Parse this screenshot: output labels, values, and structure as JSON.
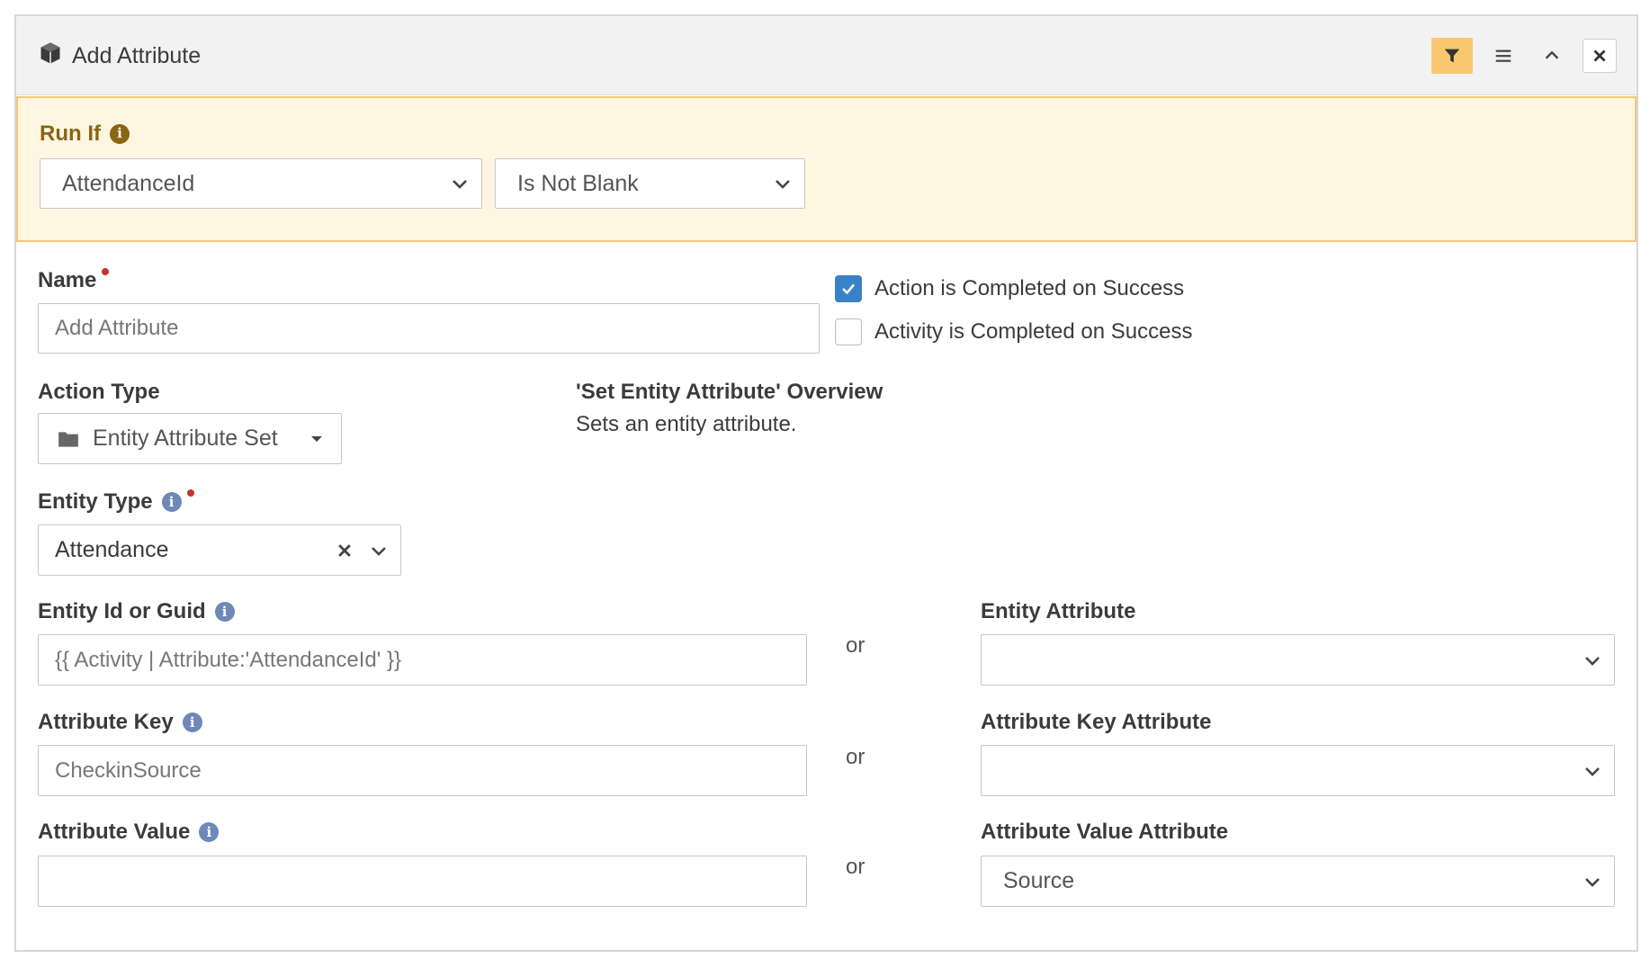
{
  "header": {
    "title": "Add Attribute",
    "icons": [
      "cube-icon",
      "filter-icon",
      "menu-icon",
      "chevron-up-icon",
      "close-icon"
    ]
  },
  "run_if": {
    "label": "Run If",
    "field_value": "AttendanceId",
    "operator_value": "Is Not Blank"
  },
  "name": {
    "label": "Name",
    "value": "Add Attribute"
  },
  "completion": {
    "action_label": "Action is Completed on Success",
    "action_checked": true,
    "activity_label": "Activity is Completed on Success",
    "activity_checked": false
  },
  "action_type": {
    "label": "Action Type",
    "value": "Entity Attribute Set"
  },
  "overview": {
    "title": "'Set Entity Attribute' Overview",
    "description": "Sets an entity attribute."
  },
  "entity_type": {
    "label": "Entity Type",
    "value": "Attendance"
  },
  "entity_id": {
    "label": "Entity Id or Guid",
    "value": "{{ Activity | Attribute:'AttendanceId' }}",
    "or": "or",
    "alt_label": "Entity Attribute",
    "alt_value": ""
  },
  "attribute_key": {
    "label": "Attribute Key",
    "value": "CheckinSource",
    "or": "or",
    "alt_label": "Attribute Key Attribute",
    "alt_value": ""
  },
  "attribute_value": {
    "label": "Attribute Value",
    "value": "",
    "or": "or",
    "alt_label": "Attribute Value Attribute",
    "alt_value": "Source"
  },
  "colors": {
    "accent": "#f8c86e",
    "runif_bg": "#fef6e1",
    "runif_border": "#f3c87a",
    "checkbox": "#3a82c7",
    "required": "#c3352b"
  }
}
